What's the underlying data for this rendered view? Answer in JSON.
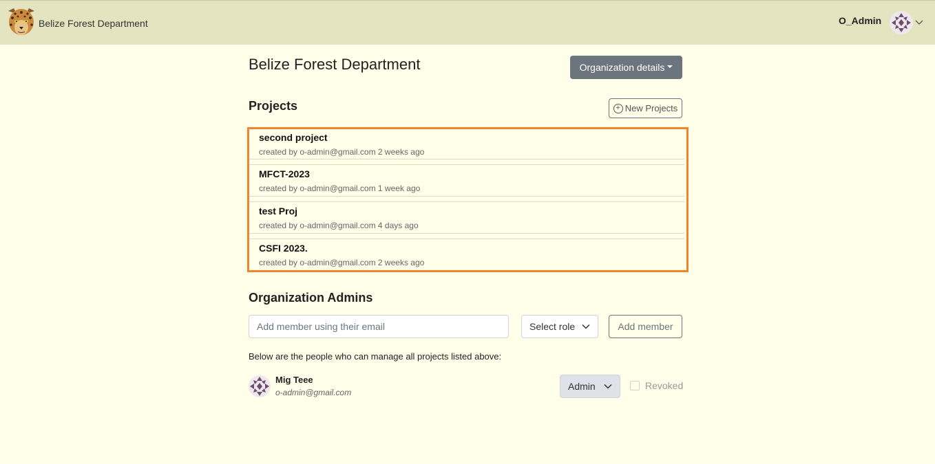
{
  "header": {
    "org_name": "Belize Forest Department",
    "user_name": "O_Admin"
  },
  "main": {
    "title": "Belize Forest Department",
    "org_details_label": "Organization details"
  },
  "projects": {
    "title": "Projects",
    "new_button_label": "New Projects",
    "items": [
      {
        "name": "second project",
        "meta": "created by o-admin@gmail.com 2 weeks ago"
      },
      {
        "name": "MFCT-2023",
        "meta": "created by o-admin@gmail.com 1 week ago"
      },
      {
        "name": "test Proj",
        "meta": "created by o-admin@gmail.com 4 days ago"
      },
      {
        "name": "CSFI 2023.",
        "meta": "created by o-admin@gmail.com 2 weeks ago"
      }
    ]
  },
  "admins": {
    "title": "Organization Admins",
    "email_placeholder": "Add member using their email",
    "select_role_label": "Select role",
    "add_member_label": "Add member",
    "info_text": "Below are the people who can manage all projects listed above:",
    "members": [
      {
        "name": "Mig Teee",
        "email": "o-admin@gmail.com",
        "role": "Admin",
        "revoked_label": "Revoked"
      }
    ]
  },
  "colors": {
    "topbar_bg": "#e5e4c0",
    "page_bg": "#fefee9",
    "highlight_border": "#f5832a",
    "secondary_btn": "#6c757d"
  }
}
